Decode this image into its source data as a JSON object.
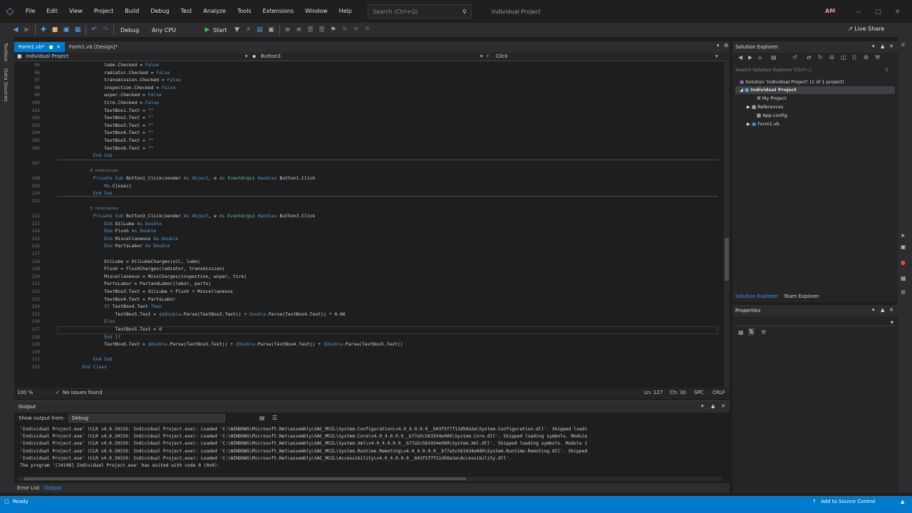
{
  "menu": {
    "items": [
      "File",
      "Edit",
      "View",
      "Project",
      "Build",
      "Debug",
      "Test",
      "Analyze",
      "Tools",
      "Extensions",
      "Window",
      "Help"
    ],
    "search_placeholder": "Search (Ctrl+Q)",
    "window_title": "Individual Project",
    "avatar_initials": "AM"
  },
  "toolbar": {
    "config": "Debug",
    "platform": "Any CPU",
    "start_label": "Start",
    "live_share": "Live Share"
  },
  "left_rail": {
    "toolbox": "Toolbox",
    "data_sources": "Data Sources"
  },
  "editor": {
    "tabs": [
      "Form1.vb*",
      "Form1.vb [Design]*"
    ],
    "nav": {
      "project": "Individual Project",
      "object": "Button3",
      "member": "Click"
    },
    "lines": [
      {
        "n": "95",
        "code": [
          {
            "t": "            lube.Checked = "
          },
          {
            "t": "False",
            "c": "kw"
          }
        ]
      },
      {
        "n": "96",
        "code": [
          {
            "t": "            radiator.Checked = "
          },
          {
            "t": "False",
            "c": "kw"
          }
        ]
      },
      {
        "n": "97",
        "code": [
          {
            "t": "            transmission.Checked = "
          },
          {
            "t": "False",
            "c": "kw"
          }
        ]
      },
      {
        "n": "98",
        "code": [
          {
            "t": "            inspection.Checked = "
          },
          {
            "t": "False",
            "c": "kw"
          }
        ]
      },
      {
        "n": "99",
        "code": [
          {
            "t": "            wiper.Checked = "
          },
          {
            "t": "False",
            "c": "kw"
          }
        ]
      },
      {
        "n": "100",
        "code": [
          {
            "t": "            tire.Checked = "
          },
          {
            "t": "False",
            "c": "kw"
          }
        ]
      },
      {
        "n": "101",
        "code": [
          {
            "t": "            TextBox1.Text = "
          },
          {
            "t": "\"\"",
            "c": "st"
          }
        ]
      },
      {
        "n": "102",
        "code": [
          {
            "t": "            TextBox2.Text = "
          },
          {
            "t": "\"\"",
            "c": "st"
          }
        ]
      },
      {
        "n": "103",
        "code": [
          {
            "t": "            TextBox3.Text = "
          },
          {
            "t": "\"\"",
            "c": "st"
          }
        ]
      },
      {
        "n": "104",
        "code": [
          {
            "t": "            TextBox4.Text = "
          },
          {
            "t": "\"\"",
            "c": "st"
          }
        ]
      },
      {
        "n": "105",
        "code": [
          {
            "t": "            TextBox5.Text = "
          },
          {
            "t": "\"\"",
            "c": "st"
          }
        ]
      },
      {
        "n": "106",
        "code": [
          {
            "t": "            TextBox6.Text = "
          },
          {
            "t": "\"\"",
            "c": "st"
          }
        ]
      },
      {
        "n": "",
        "code": [
          {
            "t": "        "
          },
          {
            "t": "End Sub",
            "c": "kw"
          }
        ]
      },
      {
        "n": "107",
        "code": []
      },
      {
        "n": "",
        "code": [
          {
            "t": "        0 references",
            "c": "cm"
          }
        ]
      },
      {
        "n": "108",
        "code": [
          {
            "t": "        "
          },
          {
            "t": "Private Sub",
            "c": "kw"
          },
          {
            "t": " Button1_Click(sender "
          },
          {
            "t": "As",
            "c": "kw"
          },
          {
            "t": " "
          },
          {
            "t": "Object",
            "c": "kw"
          },
          {
            "t": ", e "
          },
          {
            "t": "As",
            "c": "kw"
          },
          {
            "t": " "
          },
          {
            "t": "EventArgs",
            "c": "ty"
          },
          {
            "t": ") "
          },
          {
            "t": "Handles",
            "c": "kw"
          },
          {
            "t": " Button1.Click"
          }
        ]
      },
      {
        "n": "109",
        "code": [
          {
            "t": "            "
          },
          {
            "t": "Me",
            "c": "kw"
          },
          {
            "t": ".Close()"
          }
        ]
      },
      {
        "n": "110",
        "code": [
          {
            "t": "        "
          },
          {
            "t": "End Sub",
            "c": "kw"
          }
        ]
      },
      {
        "n": "111",
        "code": []
      },
      {
        "n": "",
        "code": [
          {
            "t": "        0 references",
            "c": "cm"
          }
        ]
      },
      {
        "n": "112",
        "code": [
          {
            "t": "        "
          },
          {
            "t": "Private Sub",
            "c": "kw"
          },
          {
            "t": " Button3_Click(sender "
          },
          {
            "t": "As",
            "c": "kw"
          },
          {
            "t": " "
          },
          {
            "t": "Object",
            "c": "kw"
          },
          {
            "t": ", e "
          },
          {
            "t": "As",
            "c": "kw"
          },
          {
            "t": " "
          },
          {
            "t": "EventArgs",
            "c": "ty"
          },
          {
            "t": ") "
          },
          {
            "t": "Handles",
            "c": "kw"
          },
          {
            "t": " Button3.Click"
          }
        ]
      },
      {
        "n": "113",
        "code": [
          {
            "t": "            "
          },
          {
            "t": "Dim",
            "c": "kw"
          },
          {
            "t": " OilLube "
          },
          {
            "t": "As Double",
            "c": "kw"
          }
        ]
      },
      {
        "n": "114",
        "code": [
          {
            "t": "            "
          },
          {
            "t": "Dim",
            "c": "kw"
          },
          {
            "t": " Flush "
          },
          {
            "t": "As Double",
            "c": "kw"
          }
        ]
      },
      {
        "n": "115",
        "code": [
          {
            "t": "            "
          },
          {
            "t": "Dim",
            "c": "kw"
          },
          {
            "t": " Miscellaneous "
          },
          {
            "t": "As Double",
            "c": "kw"
          }
        ]
      },
      {
        "n": "116",
        "code": [
          {
            "t": "            "
          },
          {
            "t": "Dim",
            "c": "kw"
          },
          {
            "t": " PartsLabor "
          },
          {
            "t": "As Double",
            "c": "kw"
          }
        ]
      },
      {
        "n": "117",
        "code": []
      },
      {
        "n": "118",
        "code": [
          {
            "t": "            OilLube = OilLubeCharges(oil, lube)"
          }
        ]
      },
      {
        "n": "119",
        "code": [
          {
            "t": "            Flush = FlushCharges(radiator, transmission)"
          }
        ]
      },
      {
        "n": "120",
        "code": [
          {
            "t": "            Miscellaneous = MiscCharges(inspection, wiper, tire)"
          }
        ]
      },
      {
        "n": "121",
        "code": [
          {
            "t": "            PartsLabor = PartandLabor(labor, parts)"
          }
        ]
      },
      {
        "n": "122",
        "code": [
          {
            "t": "            TextBox3.Text = OilLube + Flush + Miscellaneous"
          }
        ]
      },
      {
        "n": "123",
        "code": [
          {
            "t": "            TextBox4.Text = PartsLabor"
          }
        ]
      },
      {
        "n": "124",
        "code": [
          {
            "t": "            "
          },
          {
            "t": "If",
            "c": "kw"
          },
          {
            "t": " TextBox4.Text "
          },
          {
            "t": "Then",
            "c": "kw"
          }
        ]
      },
      {
        "n": "125",
        "code": [
          {
            "t": "                TextBox5.Text = (("
          },
          {
            "t": "Double",
            "c": "kw"
          },
          {
            "t": ".Parse(TextBox3.Text)) + "
          },
          {
            "t": "Double",
            "c": "kw"
          },
          {
            "t": ".Parse(TextBox4.Text)) * 0.06"
          }
        ]
      },
      {
        "n": "126",
        "code": [
          {
            "t": "            "
          },
          {
            "t": "Else",
            "c": "kw"
          }
        ]
      },
      {
        "n": "127",
        "code": [
          {
            "t": "                TextBox5.Text = 0"
          }
        ]
      },
      {
        "n": "128",
        "code": [
          {
            "t": "            "
          },
          {
            "t": "End If",
            "c": "kw"
          }
        ]
      },
      {
        "n": "129",
        "code": [
          {
            "t": "            TextBox6.Text = ("
          },
          {
            "t": "Double",
            "c": "kw"
          },
          {
            "t": ".Parse(TextBox3.Text)) + ("
          },
          {
            "t": "Double",
            "c": "kw"
          },
          {
            "t": ".Parse(TextBox4.Text)) + ("
          },
          {
            "t": "Double",
            "c": "kw"
          },
          {
            "t": ".Parse(TextBox5.Text))"
          }
        ]
      },
      {
        "n": "130",
        "code": []
      },
      {
        "n": "131",
        "code": [
          {
            "t": "        "
          },
          {
            "t": "End Sub",
            "c": "kw"
          }
        ]
      },
      {
        "n": "132",
        "code": [
          {
            "t": "    "
          },
          {
            "t": "End Class",
            "c": "kw"
          }
        ]
      }
    ],
    "status": {
      "zoom": "100 %",
      "issues": "No issues found",
      "ln": "Ln: 127",
      "ch": "Ch: 30",
      "spc": "SPC",
      "crlf": "CRLF"
    }
  },
  "output": {
    "title": "Output",
    "show_from_label": "Show output from:",
    "show_from_value": "Debug",
    "lines": [
      "'Individual Project.exe' (CLR v4.0.30319: Individual Project.exe): Loaded 'C:\\WINDOWS\\Microsoft.Net\\assembly\\GAC_MSIL\\System.Configuration\\v4.0_4.0.0.0__b03f5f7f11d50a3a\\System.Configuration.dll'. Skipped loadi",
      "'Individual Project.exe' (CLR v4.0.30319: Individual Project.exe): Loaded 'C:\\WINDOWS\\Microsoft.Net\\assembly\\GAC_MSIL\\System.Core\\v4.0_4.0.0.0__b77a5c561934e089\\System.Core.dll'. Skipped loading symbols. Module",
      "'Individual Project.exe' (CLR v4.0.30319: Individual Project.exe): Loaded 'C:\\WINDOWS\\Microsoft.Net\\assembly\\GAC_MSIL\\System.Xml\\v4.0_4.0.0.0__b77a5c561934e089\\System.Xml.dll'. Skipped loading symbols. Module i",
      "'Individual Project.exe' (CLR v4.0.30319: Individual Project.exe): Loaded 'C:\\WINDOWS\\Microsoft.Net\\assembly\\GAC_MSIL\\System.Runtime.Remoting\\v4.0_4.0.0.0__b77a5c561934e089\\System.Runtime.Remoting.dll'. Skipped",
      "'Individual Project.exe' (CLR v4.0.30319: Individual Project.exe): Loaded 'C:\\WINDOWS\\Microsoft.Net\\assembly\\GAC_MSIL\\Accessibility\\v4.0_4.0.0.0__b03f5f7f11d50a3a\\Accessibility.dll'.",
      "The program '[14108] Individual Project.exe' has exited with code 0 (0x0)."
    ]
  },
  "bottom_tabs": {
    "error_list": "Error List",
    "output": "Output"
  },
  "solution_explorer": {
    "title": "Solution Explorer",
    "search_placeholder": "Search Solution Explorer (Ctrl+;)",
    "solution": "Solution 'Individual Project' (1 of 1 project)",
    "project": "Individual Project",
    "items": [
      "My Project",
      "References",
      "App.config",
      "Form1.vb"
    ],
    "tabs": [
      "Solution Explorer",
      "Team Explorer"
    ]
  },
  "properties": {
    "title": "Properties"
  },
  "statusbar": {
    "ready": "Ready",
    "source_control": "Add to Source Control"
  },
  "colors": {
    "accent": "#007acc",
    "keyword": "#569cd6",
    "type": "#4ec9b0",
    "string": "#d69d85"
  }
}
